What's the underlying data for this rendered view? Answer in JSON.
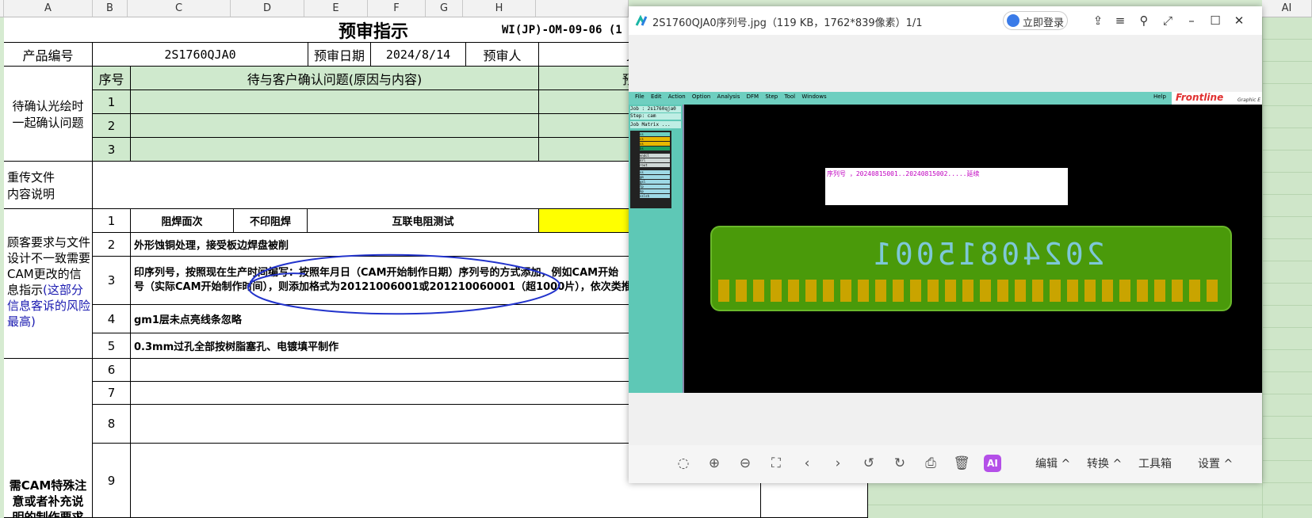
{
  "columns": [
    "A",
    "B",
    "C",
    "D",
    "E",
    "F",
    "G",
    "H",
    "AI"
  ],
  "sheet": {
    "title": "预审指示",
    "doc_no": "WI(JP)-OM-09-06 (1",
    "product_label": "产品编号",
    "product_value": "2S1760QJA0",
    "review_date_label": "预审日期",
    "review_date_value": "2024/8/14",
    "reviewer_label": "预审人",
    "reviewer_partial": "J",
    "confirm_section": "待确认光绘时一起确认问题",
    "seq_header": "序号",
    "question_header": "待与客户确认问题(原因与内容)",
    "pre_header_partial": "预",
    "reupload_label": "重传文件\n内容说明",
    "diff_section_a": "顾客要求与文件设计不一致需要CAM更改的信息指示",
    "diff_section_b": "(这部分信息客诉的风险最高)",
    "special_section": "需CAM特殊注意或者补充说明的制作要求",
    "rows": [
      {
        "no": "1",
        "text": ""
      },
      {
        "no": "2",
        "text": ""
      },
      {
        "no": "3",
        "text": ""
      }
    ],
    "item1_a": "阻焊面次",
    "item1_b": "不印阻焊",
    "item1_c": "互联电阻测试",
    "item2": "外形蚀铜处理，接受板边焊盘被削",
    "item3_line1": "印序列号，按照现在生产时间编写：按照年月日（CAM开始制作日期）序列号的方式添加，例如CAM开始",
    "item3_line2": "号（实际CAM开始制作时间），则添加格式为20121006001或201210060001（超1000片），依次类推",
    "item4": "gm1层未点亮线条忽略",
    "item5": "0.3mm过孔全部按树脂塞孔、电镀填平制作",
    "nums": [
      "1",
      "2",
      "3",
      "4",
      "5",
      "6",
      "7",
      "8",
      "9"
    ]
  },
  "viewer": {
    "title": "2S1760QJA0序列号.jpg（119 KB，1762*839像素）1/1",
    "login": "立即登录",
    "toolbar": {
      "edit": "编辑",
      "convert": "转换",
      "toolbox": "工具箱",
      "settings": "设置",
      "ai": "AI"
    },
    "cam": {
      "menu": [
        "File",
        "Edit",
        "Action",
        "Option",
        "Analysis",
        "DFM",
        "Step",
        "Tool",
        "Windows"
      ],
      "help": "Help",
      "brand": "Frontline",
      "brand_sub": "Graphic E",
      "job": "Job : 2s1760qja0",
      "step": "Step: cam",
      "matrix": "Job Matrix ...",
      "layers": [
        "ss",
        "cs",
        "ss",
        "bs",
        "endcl",
        "drl",
        "rout",
        "ss",
        "gm",
        "gsl",
        "tp",
        "bp",
        "sslsh"
      ],
      "note": "序列号 ，20240815001..20240815002.....延续",
      "serial": "20240815001"
    }
  },
  "colors": {
    "accent_green": "#cfe9cd",
    "yellow": "#ffff00",
    "pcb_green": "#4a9a0a",
    "pad_gold": "#c9a400",
    "note_magenta": "#c000c0"
  }
}
